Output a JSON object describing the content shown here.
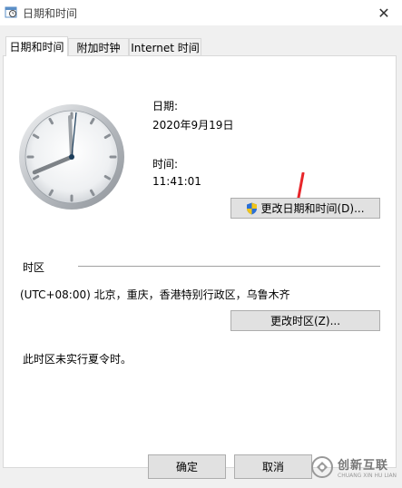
{
  "window": {
    "title": "日期和时间",
    "close_symbol": "✕"
  },
  "tabs": [
    {
      "label": "日期和时间",
      "active": true
    },
    {
      "label": "附加时钟",
      "active": false
    },
    {
      "label": "Internet 时间",
      "active": false
    }
  ],
  "datetime": {
    "date_label": "日期:",
    "date_value": "2020年9月19日",
    "time_label": "时间:",
    "time_value": "11:41:01",
    "change_button": "更改日期和时间(D)..."
  },
  "timezone": {
    "section_label": "时区",
    "value": "(UTC+08:00) 北京，重庆，香港特别行政区，乌鲁木齐",
    "change_button": "更改时区(Z)...",
    "dst_note": "此时区未实行夏令时。"
  },
  "footer": {
    "ok": "确定",
    "cancel": "取消"
  },
  "watermark": {
    "text": "创新互联",
    "sub": "CHUANG XIN HU LIAN"
  },
  "icons": {
    "title": "date-time-icon",
    "shield": "uac-shield-icon",
    "clock": "analog-clock-icon",
    "arrow": "red-annotation-arrow"
  },
  "colors": {
    "panel_bg": "#ffffff",
    "dialog_bg": "#f0f0f0",
    "button_bg": "#e1e1e1",
    "button_border": "#adadad",
    "annotation_arrow": "#e8262a",
    "clock_second_hand": "#1c3d5a"
  }
}
